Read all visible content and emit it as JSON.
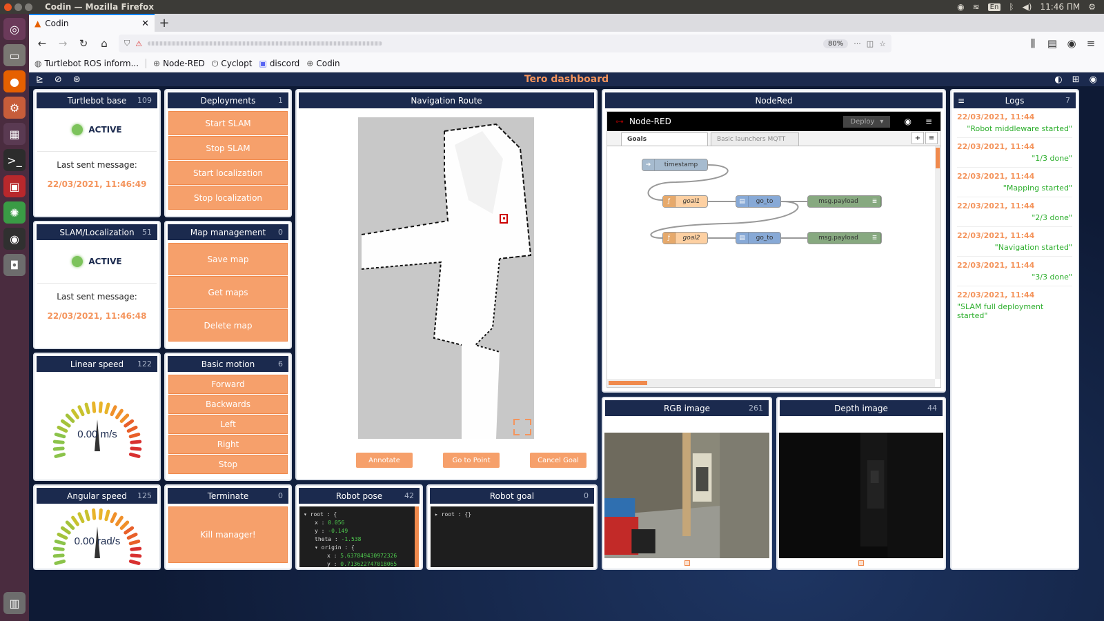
{
  "os": {
    "window_title": "Codin — Mozilla Firefox",
    "lang": "En",
    "clock": "11:46 ПМ"
  },
  "browser": {
    "tab_title": "Codin",
    "zoom": "80%",
    "bookmarks": [
      {
        "label": "Turtlebot ROS inform...",
        "icon": "github-icon"
      },
      {
        "label": "Node-RED",
        "icon": "globe-icon"
      },
      {
        "label": "Cyclopt",
        "icon": "power-icon"
      },
      {
        "label": "discord",
        "icon": "discord-icon"
      },
      {
        "label": "Codin",
        "icon": "globe-icon"
      }
    ]
  },
  "app": {
    "title": "Tero dashboard"
  },
  "turtlebot_base": {
    "title": "Turtlebot base",
    "count": "109",
    "status": "ACTIVE",
    "last_label": "Last sent message:",
    "last_time": "22/03/2021, 11:46:49"
  },
  "slam": {
    "title": "SLAM/Localization",
    "count": "51",
    "status": "ACTIVE",
    "last_label": "Last sent message:",
    "last_time": "22/03/2021, 11:46:48"
  },
  "deployments": {
    "title": "Deployments",
    "count": "1",
    "buttons": [
      "Start SLAM",
      "Stop SLAM",
      "Start localization",
      "Stop localization"
    ]
  },
  "map_management": {
    "title": "Map management",
    "count": "0",
    "buttons": [
      "Save map",
      "Get maps",
      "Delete map"
    ]
  },
  "linear_speed": {
    "title": "Linear speed",
    "count": "122",
    "value": "0.00",
    "unit": "m/s",
    "level": 0
  },
  "basic_motion": {
    "title": "Basic motion",
    "count": "6",
    "buttons": [
      "Forward",
      "Backwards",
      "Left",
      "Right",
      "Stop"
    ]
  },
  "angular_speed": {
    "title": "Angular speed",
    "count": "125",
    "value": "0.00",
    "unit": "rad/s",
    "level": 0
  },
  "terminate": {
    "title": "Terminate",
    "count": "0",
    "button": "Kill manager!"
  },
  "navigation": {
    "title": "Navigation Route",
    "buttons": [
      "Annotate",
      "Go to Point",
      "Cancel Goal"
    ]
  },
  "robot_pose": {
    "title": "Robot pose",
    "count": "42",
    "lines": [
      {
        "key": "root : {",
        "val": ""
      },
      {
        "key": "x : ",
        "val": "0.056"
      },
      {
        "key": "y : ",
        "val": "-0.149"
      },
      {
        "key": "theta : ",
        "val": "-1.538"
      },
      {
        "key": "origin : {",
        "val": ""
      },
      {
        "key": "x : ",
        "val": "5.637849430972326"
      },
      {
        "key": "y : ",
        "val": "0.713622747018065"
      }
    ]
  },
  "robot_goal": {
    "title": "Robot goal",
    "count": "0",
    "line": "root : {}"
  },
  "nodered": {
    "title": "NodeRed",
    "brand": "Node-RED",
    "deploy": "Deploy",
    "tabs": [
      "Goals",
      "Basic launchers MQTT"
    ],
    "nodes": {
      "timestamp": "timestamp",
      "goal1": "goal1",
      "goal2": "goal2",
      "go_to": "go_to",
      "debug": "msg.payload"
    }
  },
  "rgb": {
    "title": "RGB image",
    "count": "261"
  },
  "depth": {
    "title": "Depth image",
    "count": "44"
  },
  "logs": {
    "title": "Logs",
    "count": "7",
    "entries": [
      {
        "ts": "22/03/2021, 11:44",
        "msg": "\"Robot middleware started\""
      },
      {
        "ts": "22/03/2021, 11:44",
        "msg": "\"1/3 done\""
      },
      {
        "ts": "22/03/2021, 11:44",
        "msg": "\"Mapping started\""
      },
      {
        "ts": "22/03/2021, 11:44",
        "msg": "\"2/3 done\""
      },
      {
        "ts": "22/03/2021, 11:44",
        "msg": "\"Navigation started\""
      },
      {
        "ts": "22/03/2021, 11:44",
        "msg": "\"3/3 done\""
      },
      {
        "ts": "22/03/2021, 11:44",
        "msg": "\"SLAM full deployment started\""
      }
    ]
  },
  "colors": {
    "accent": "#f4945c",
    "header": "#1b2a4e",
    "button": "#f6a06b",
    "active": "#7cc35b",
    "log_msg": "#2cae2c"
  }
}
